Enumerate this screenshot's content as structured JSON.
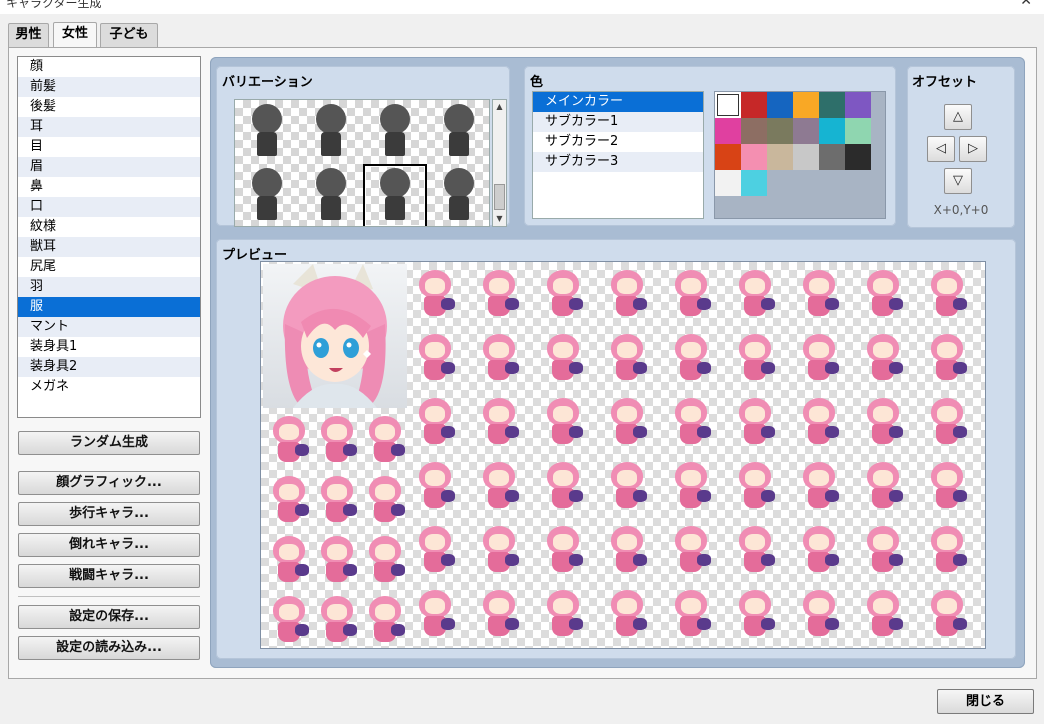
{
  "window": {
    "title": "キャラクター生成"
  },
  "tabs": [
    {
      "label": "男性",
      "active": false
    },
    {
      "label": "女性",
      "active": true
    },
    {
      "label": "子ども",
      "active": false
    }
  ],
  "parts_list": {
    "items": [
      "顔",
      "前髪",
      "後髪",
      "耳",
      "目",
      "眉",
      "鼻",
      "口",
      "紋様",
      "獣耳",
      "尻尾",
      "羽",
      "服",
      "マント",
      "装身具1",
      "装身具2",
      "メガネ"
    ],
    "selected": "服"
  },
  "buttons": {
    "random": "ランダム生成",
    "face": "顔グラフィック...",
    "walk": "歩行キャラ...",
    "damage": "倒れキャラ...",
    "battle": "戦闘キャラ...",
    "save": "設定の保存...",
    "load": "設定の読み込み...",
    "close": "閉じる"
  },
  "variation": {
    "label": "バリエーション",
    "item_count": 8,
    "selected_index": 6,
    "icons": {
      "up": "scroll-up-icon",
      "down": "scroll-down-icon"
    }
  },
  "color": {
    "label": "色",
    "items": [
      "メインカラー",
      "サブカラー1",
      "サブカラー2",
      "サブカラー3"
    ],
    "selected": "メインカラー",
    "swatches": [
      "#ffffff",
      "#c62828",
      "#1565c0",
      "#f9a825",
      "#2e6f6a",
      "#7e57c2",
      "#e040a0",
      "#8d6e63",
      "#7a7a5e",
      "#8e7a92",
      "#16b4d2",
      "#8fd6b0",
      "#d84315",
      "#f48fb1",
      "#c9b79c",
      "#c8c8c8",
      "#6d6d6d",
      "#2b2b2b",
      "#f2f2f2",
      "#4dd0e1"
    ]
  },
  "offset": {
    "label": "オフセット",
    "up": "△",
    "left": "◁",
    "right": "▷",
    "down": "▽",
    "value": "X+0,Y+0"
  },
  "preview": {
    "label": "プレビュー"
  }
}
